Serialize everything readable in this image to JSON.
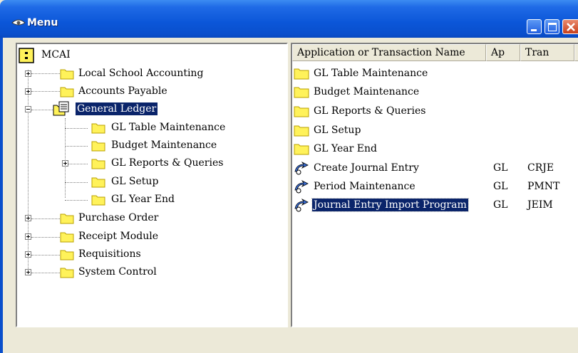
{
  "window": {
    "title": "Menu"
  },
  "tree": {
    "root": "MCAI",
    "items": [
      {
        "label": "Local School Accounting",
        "expander": "+",
        "selected": false
      },
      {
        "label": "Accounts Payable",
        "expander": "+",
        "selected": false
      },
      {
        "label": "General Ledger",
        "expander": "-",
        "selected": true,
        "children": [
          {
            "label": "GL Table Maintenance",
            "expander": ""
          },
          {
            "label": "Budget Maintenance",
            "expander": ""
          },
          {
            "label": "GL Reports & Queries",
            "expander": "+"
          },
          {
            "label": "GL Setup",
            "expander": ""
          },
          {
            "label": "GL Year End",
            "expander": ""
          }
        ]
      },
      {
        "label": "Purchase Order",
        "expander": "+",
        "selected": false
      },
      {
        "label": "Receipt Module",
        "expander": "+",
        "selected": false
      },
      {
        "label": "Requisitions",
        "expander": "+",
        "selected": false
      },
      {
        "label": "System Control",
        "expander": "+",
        "selected": false
      }
    ]
  },
  "list": {
    "columns": [
      "Application or Transaction Name",
      "Ap",
      "Tran"
    ],
    "rows": [
      {
        "icon": "folder-icon",
        "name": "GL Table Maintenance",
        "ap": "",
        "tran": ""
      },
      {
        "icon": "folder-icon",
        "name": "Budget Maintenance",
        "ap": "",
        "tran": ""
      },
      {
        "icon": "folder-icon",
        "name": "GL Reports & Queries",
        "ap": "",
        "tran": ""
      },
      {
        "icon": "folder-icon",
        "name": "GL Setup",
        "ap": "",
        "tran": ""
      },
      {
        "icon": "folder-icon",
        "name": "GL Year End",
        "ap": "",
        "tran": ""
      },
      {
        "icon": "transaction-icon",
        "name": "Create Journal Entry",
        "ap": "GL",
        "tran": "CRJE"
      },
      {
        "icon": "transaction-icon",
        "name": "Period Maintenance",
        "ap": "GL",
        "tran": "PMNT"
      },
      {
        "icon": "transaction-icon",
        "name": "Journal Entry Import Program",
        "ap": "GL",
        "tran": "JEIM",
        "selected": true
      }
    ]
  },
  "colors": {
    "titlebar": "#0a4fcc",
    "selection": "#0a246a",
    "folder": "#fff25a",
    "window_bg": "#ece9d8"
  }
}
